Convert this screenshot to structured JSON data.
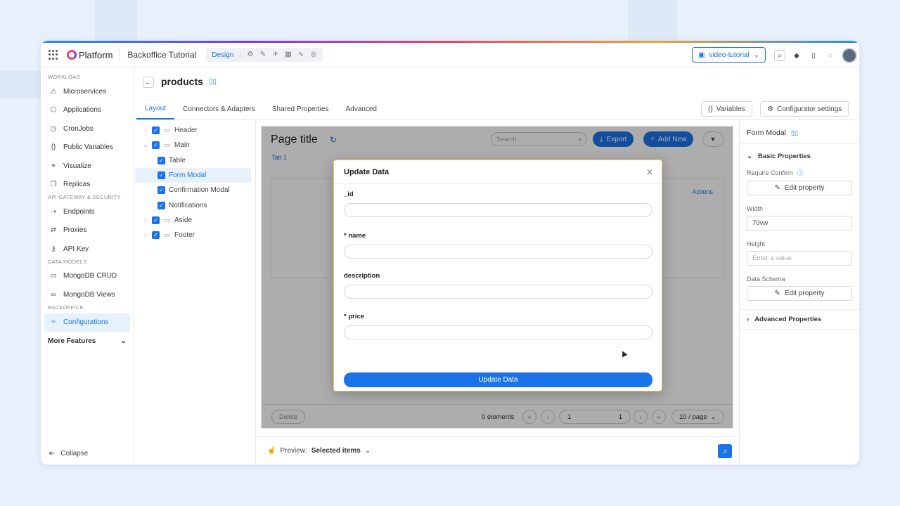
{
  "topbar": {
    "logo_text": "Platform",
    "project_title": "Backoffice Tutorial",
    "mode_label": "Design",
    "branch_label": "video-tutorial"
  },
  "sidebar": {
    "sections": [
      {
        "title": "WORKLOAD",
        "items": [
          {
            "label": "Microservices",
            "icon": "microservices-icon"
          },
          {
            "label": "Applications",
            "icon": "applications-icon"
          },
          {
            "label": "CronJobs",
            "icon": "cronjobs-icon"
          },
          {
            "label": "Public Variables",
            "icon": "braces-icon"
          },
          {
            "label": "Visualize",
            "icon": "visualize-icon"
          },
          {
            "label": "Replicas",
            "icon": "replicas-icon"
          }
        ]
      },
      {
        "title": "API GATEWAY & SECURITY",
        "items": [
          {
            "label": "Endpoints",
            "icon": "endpoints-icon"
          },
          {
            "label": "Proxies",
            "icon": "proxies-icon"
          },
          {
            "label": "API Key",
            "icon": "key-icon"
          }
        ]
      },
      {
        "title": "DATA MODELS",
        "items": [
          {
            "label": "MongoDB CRUD",
            "icon": "folder-icon"
          },
          {
            "label": "MongoDB Views",
            "icon": "binoculars-icon"
          }
        ]
      },
      {
        "title": "BACKOFFICE",
        "items": [
          {
            "label": "Configurations",
            "icon": "wrench-icon"
          }
        ]
      }
    ],
    "more_features": "More Features",
    "collapse": "Collapse"
  },
  "header": {
    "page_name": "products",
    "tabs": [
      "Layout",
      "Connectors & Adapters",
      "Shared Properties",
      "Advanced"
    ],
    "variables_button": "Variables",
    "configurator_button": "Configurator settings"
  },
  "tree": {
    "items": [
      {
        "label": "Header",
        "level": 0,
        "expandable": true
      },
      {
        "label": "Main",
        "level": 0,
        "expandable": true,
        "expanded": true
      },
      {
        "label": "Table",
        "level": 1
      },
      {
        "label": "Form Modal",
        "level": 1,
        "selected": true
      },
      {
        "label": "Confirmation Modal",
        "level": 1
      },
      {
        "label": "Notifications",
        "level": 1
      },
      {
        "label": "Aside",
        "level": 0,
        "expandable": true
      },
      {
        "label": "Footer",
        "level": 0,
        "expandable": true
      }
    ]
  },
  "canvas": {
    "page_title": "Page title",
    "search_placeholder": "Search...",
    "export_label": "Export",
    "add_new_label": "Add New",
    "tab_label": "Tab 1",
    "actions_label": "Actions",
    "delete_label": "Delete",
    "elements_count": "0 elements",
    "page_current": "1",
    "page_total": "1",
    "per_page": "10 / page"
  },
  "modal": {
    "title": "Update Data",
    "fields": [
      {
        "label": "_id"
      },
      {
        "label": "* name"
      },
      {
        "label": "description"
      },
      {
        "label": "* price"
      }
    ],
    "submit_label": "Update Data"
  },
  "preview_bar": {
    "label": "Preview:",
    "value": "Selected items"
  },
  "right_panel": {
    "title": "Form Modal",
    "basic_properties": "Basic Properties",
    "require_confirm_label": "Require Confirm",
    "edit_property": "Edit property",
    "width_label": "Width",
    "width_value": "70vw",
    "height_label": "Height",
    "height_placeholder": "Enter a value",
    "data_schema_label": "Data Schema",
    "advanced_properties": "Advanced Properties"
  },
  "colors": {
    "accent": "#1a73e8",
    "background": "#e8f1fb"
  }
}
